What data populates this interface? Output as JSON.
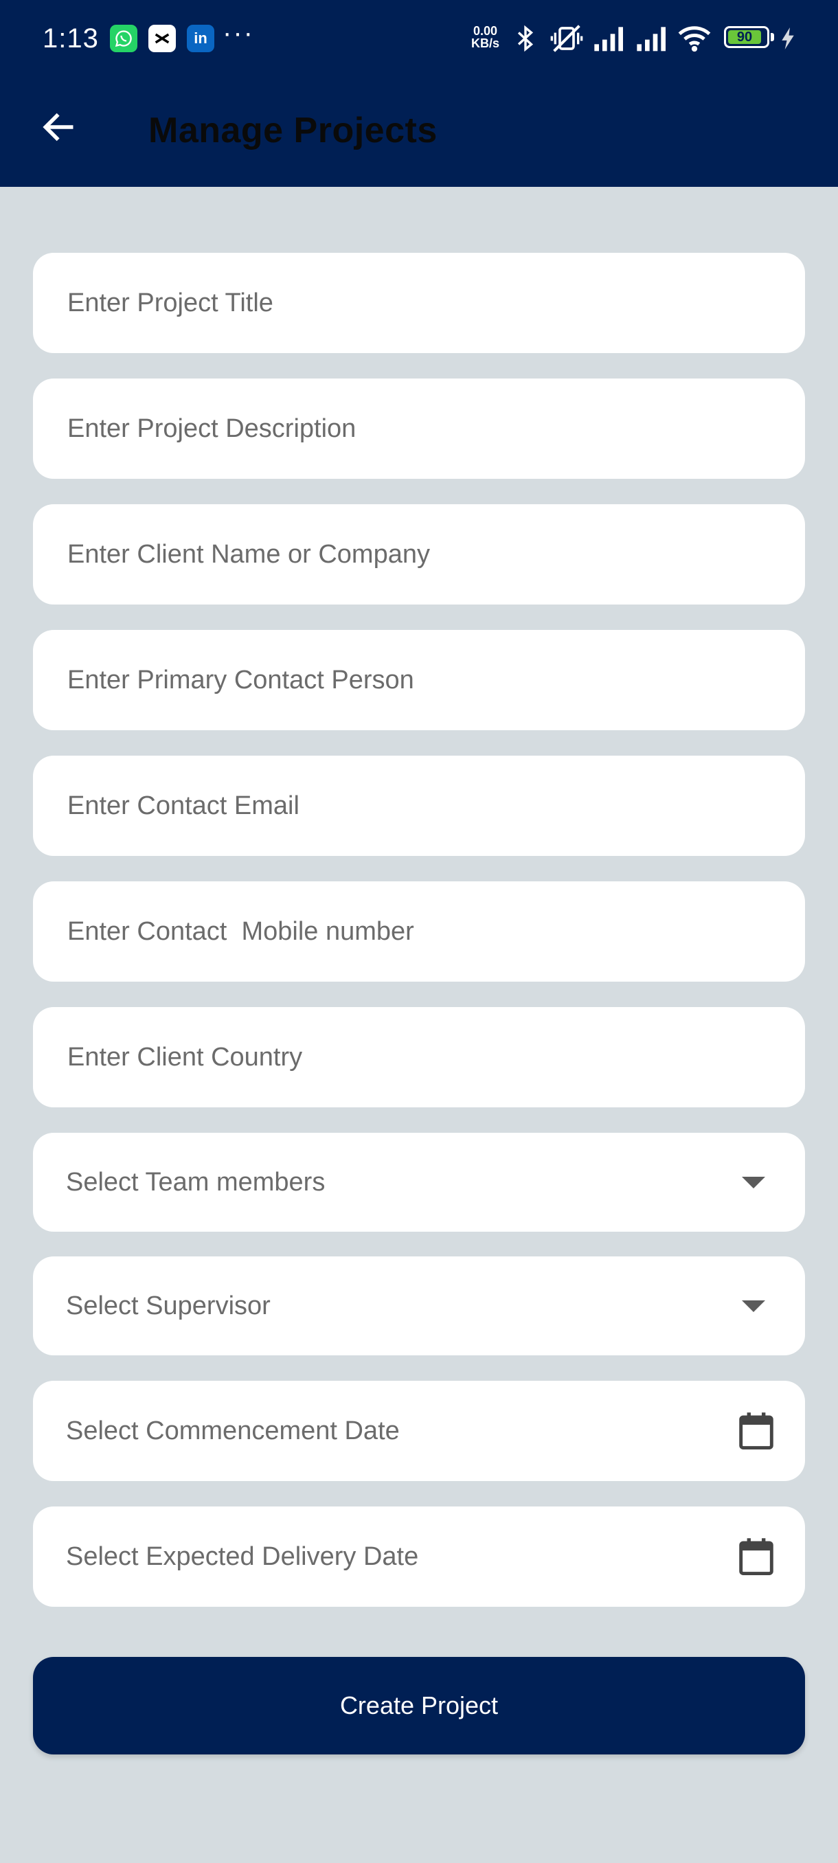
{
  "status_bar": {
    "time": "1:13",
    "notification_icons": [
      "whatsapp-icon",
      "capcut-icon",
      "linkedin-icon"
    ],
    "linkedin_text": "in",
    "overflow": "···",
    "net_speed_value": "0.00",
    "net_speed_unit": "KB/s",
    "battery_level": "90",
    "battery_color": "#6ac63a"
  },
  "header": {
    "title": "Manage Projects",
    "background": "#001f54"
  },
  "form": {
    "project_title_placeholder": "Enter Project Title",
    "project_description_placeholder": "Enter Project Description",
    "client_name_placeholder": "Enter Client Name or Company",
    "primary_contact_placeholder": "Enter Primary Contact Person",
    "contact_email_placeholder": "Enter Contact Email",
    "contact_mobile_placeholder": "Enter Contact  Mobile number",
    "client_country_placeholder": "Enter Client Country",
    "team_members_label": "Select Team members",
    "supervisor_label": "Select Supervisor",
    "commencement_date_label": "Select Commencement Date",
    "delivery_date_label": "Select Expected Delivery Date"
  },
  "actions": {
    "create_label": "Create Project"
  }
}
